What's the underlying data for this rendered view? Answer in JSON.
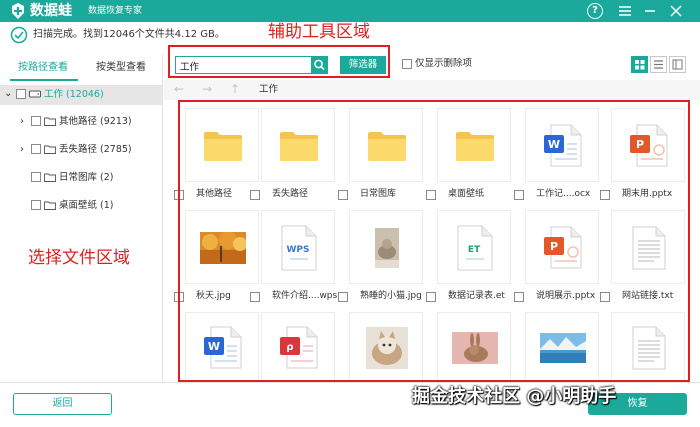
{
  "app": {
    "name": "数据蛙",
    "subtitle": "数据恢复专家",
    "accent_color": "#1aa99a"
  },
  "status": {
    "text": "扫描完成。找到12046个文件共4.12 GB。"
  },
  "annotations": {
    "top": "辅助工具区域",
    "left": "选择文件区域",
    "color": "#e02020"
  },
  "sidebar": {
    "tabs": [
      {
        "label": "按路径查看",
        "active": true
      },
      {
        "label": "按类型查看",
        "active": false
      }
    ],
    "tree": [
      {
        "label": "工作 (12046)",
        "root": true,
        "icon": "drive-icon"
      },
      {
        "label": "其他路径 (9213)",
        "expandable": true,
        "icon": "folder-icon"
      },
      {
        "label": "丢失路径 (2785)",
        "expandable": true,
        "icon": "folder-icon"
      },
      {
        "label": "日常图库 (2)",
        "expandable": false,
        "icon": "folder-icon"
      },
      {
        "label": "桌面壁纸 (1)",
        "expandable": false,
        "icon": "folder-icon"
      }
    ]
  },
  "toolbar": {
    "search_value": "工作",
    "filter_label": "筛选器",
    "only_deleted_label": "仅显示删除项"
  },
  "nav": {
    "back": "←",
    "forward": "→",
    "up": "↑",
    "crumb": "工作"
  },
  "files": [
    {
      "name": "其他路径",
      "kind": "folder-icon"
    },
    {
      "name": "丢失路径",
      "kind": "folder-icon"
    },
    {
      "name": "日常图库",
      "kind": "folder-icon"
    },
    {
      "name": "桌面壁纸",
      "kind": "folder-icon"
    },
    {
      "name": "工作记....ocx",
      "kind": "word-icon"
    },
    {
      "name": "期末用.pptx",
      "kind": "ppt-icon"
    },
    {
      "name": "秋天.jpg",
      "kind": "autumn-image-icon"
    },
    {
      "name": "软件介绍....wps",
      "kind": "wps-icon"
    },
    {
      "name": "熟睡的小猫.jpg",
      "kind": "cat-image-icon"
    },
    {
      "name": "数据记录表.et",
      "kind": "et-icon"
    },
    {
      "name": "说明展示.pptx",
      "kind": "ppt-icon"
    },
    {
      "name": "网站链接.txt",
      "kind": "txt-icon"
    },
    {
      "name": "",
      "kind": "word-icon"
    },
    {
      "name": "",
      "kind": "pdf-icon"
    },
    {
      "name": "",
      "kind": "kitten-image-icon"
    },
    {
      "name": "",
      "kind": "rabbit-image-icon"
    },
    {
      "name": "",
      "kind": "lake-image-icon"
    },
    {
      "name": "",
      "kind": "txt-icon"
    }
  ],
  "footer": {
    "back_label": "返回",
    "recover_label": "恢复"
  },
  "watermark": "掘金技术社区 @小明助手"
}
